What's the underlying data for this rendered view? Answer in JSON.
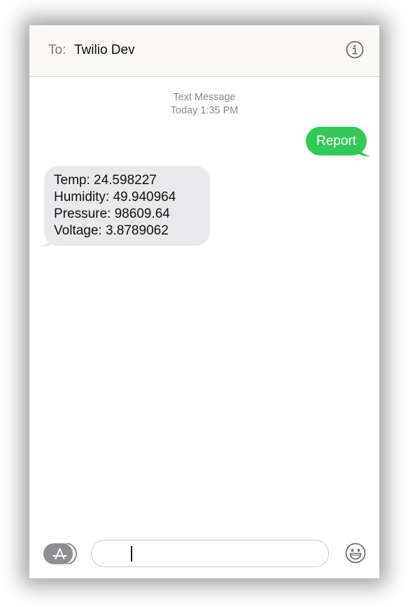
{
  "header": {
    "to_label": "To:",
    "recipient": "Twilio Dev",
    "info_icon": "info-circle-icon"
  },
  "conversation": {
    "service_label": "Text Message",
    "timestamp": "Today 1:35 PM",
    "messages": [
      {
        "direction": "outgoing",
        "lines": [
          "Report"
        ],
        "color": "#34c759"
      },
      {
        "direction": "incoming",
        "lines": [
          "Temp: 24.598227",
          "Humidity: 49.940964",
          "Pressure: 98609.64",
          "Voltage: 3.8789062"
        ],
        "color": "#e9e9eb"
      }
    ]
  },
  "composer": {
    "apps_icon": "app-store-icon",
    "input_value": "",
    "emoji_icon": "emoji-smile-icon"
  }
}
